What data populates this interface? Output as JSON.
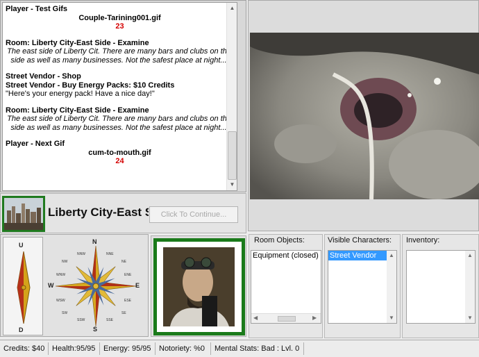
{
  "log": {
    "entries": [
      {
        "type": "title",
        "text": "Player - Test Gifs"
      },
      {
        "type": "center",
        "text": "Couple-Tarining001.gif"
      },
      {
        "type": "num",
        "text": "23"
      },
      {
        "type": "gap"
      },
      {
        "type": "title",
        "text": "Room: Liberty City-East Side - Examine"
      },
      {
        "type": "desc",
        "text": "The east side of Liberty Cit. There are many bars and clubs on this side as well as many businesses. Not the safest place at night...."
      },
      {
        "type": "gap"
      },
      {
        "type": "title",
        "text": "Street Vendor - Shop"
      },
      {
        "type": "title",
        "text": "Street Vendor - Buy Energy Packs: $10 Credits"
      },
      {
        "type": "plain",
        "text": "\"Here's your energy pack! Have a nice day!\""
      },
      {
        "type": "gap"
      },
      {
        "type": "title",
        "text": "Room: Liberty City-East Side - Examine"
      },
      {
        "type": "desc",
        "text": "The east side of Liberty Cit. There are many bars and clubs on this side as well as many businesses. Not the safest place at night...."
      },
      {
        "type": "gap"
      },
      {
        "type": "title",
        "text": "Player - Next Gif"
      },
      {
        "type": "center",
        "text": "cum-to-mouth.gif"
      },
      {
        "type": "num",
        "text": "24"
      }
    ]
  },
  "location": {
    "name": "Liberty City-East Side",
    "continue_label": "Click To Continue..."
  },
  "compass": {
    "up": "U",
    "down": "D",
    "n": "N",
    "s": "S",
    "e": "E",
    "w": "W",
    "nnw": "NNW",
    "nw": "NW",
    "wnw": "WNW",
    "wsw": "WSW",
    "sw": "SW",
    "ssw": "SSW",
    "nne": "NNE",
    "ne": "NE",
    "ene": "ENE",
    "ese": "ESE",
    "se": "SE",
    "sse": "SSE"
  },
  "room_objects": {
    "label": "Room Objects:",
    "items": [
      "Equipment (closed)"
    ]
  },
  "visible_characters": {
    "label": "Visible Characters:",
    "items": [
      "Street Vendor"
    ],
    "selected": 0
  },
  "inventory": {
    "label": "Inventory:",
    "items": []
  },
  "status": {
    "credits": "Credits: $40",
    "health": "Health:95/95",
    "energy": "Energy: 95/95",
    "notoriety": "Notoriety: %0",
    "mental": "Mental Stats: Bad : Lvl. 0"
  },
  "colors": {
    "accent_green": "#1f7a1f",
    "number_red": "#d40000",
    "selection_blue": "#3399ff"
  }
}
